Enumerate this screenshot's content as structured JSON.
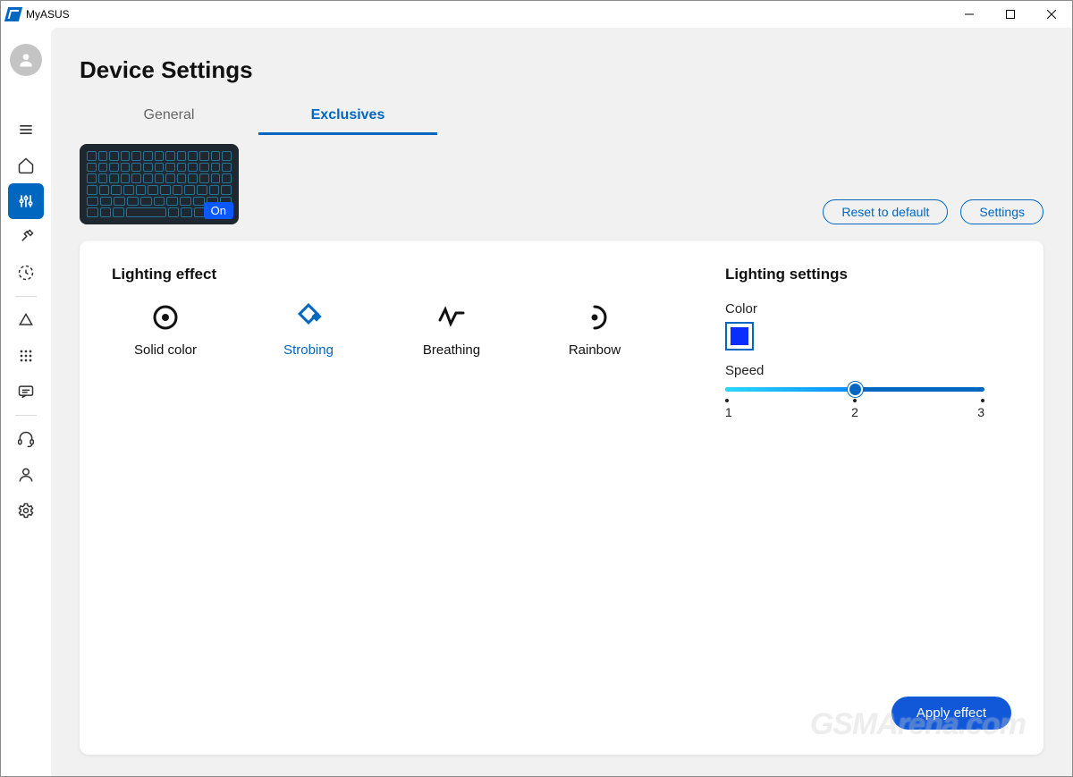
{
  "app": {
    "title": "MyASUS"
  },
  "page": {
    "title": "Device Settings"
  },
  "tabs": {
    "general": "General",
    "exclusives": "Exclusives"
  },
  "keyboard": {
    "badge": "On"
  },
  "buttons": {
    "reset": "Reset to default",
    "settings": "Settings",
    "apply": "Apply effect"
  },
  "lighting_effect": {
    "title": "Lighting effect",
    "options": {
      "solid": "Solid color",
      "strobing": "Strobing",
      "breathing": "Breathing",
      "rainbow": "Rainbow"
    }
  },
  "lighting_settings": {
    "title": "Lighting settings",
    "color_label": "Color",
    "color_value": "#0a2eff",
    "speed_label": "Speed",
    "speed_min": "1",
    "speed_mid": "2",
    "speed_max": "3",
    "speed_value": 2
  },
  "watermark": "GSMArena.com"
}
